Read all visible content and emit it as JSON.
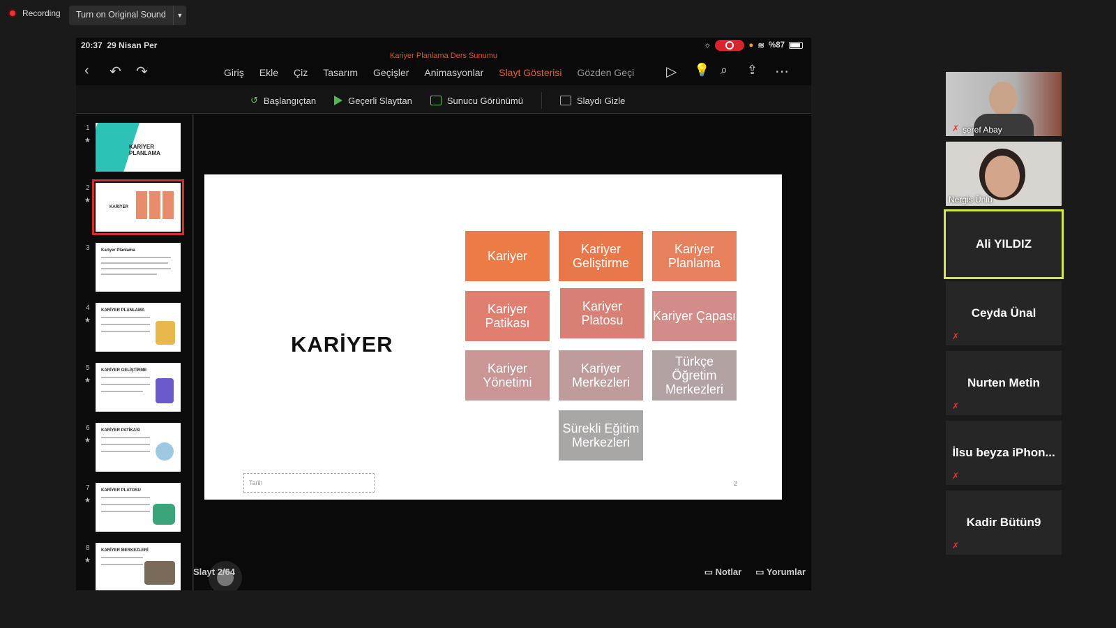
{
  "recording": {
    "label": "Recording"
  },
  "sound_button": {
    "label": "Turn on Original Sound"
  },
  "ipad": {
    "time": "20:37",
    "date": "29 Nisan Per",
    "battery": "%87",
    "doc_title": "Kariyer Planlama Ders Sunumu",
    "menu": [
      "Giriş",
      "Ekle",
      "Çiz",
      "Tasarım",
      "Geçişler",
      "Animasyonlar",
      "Slayt Gösterisi",
      "Gözden Geçi"
    ],
    "menu_active": "Slayt Gösterisi",
    "ribbon": [
      "Başlangıçtan",
      "Geçerli Slayttan",
      "Sunucu Görünümü",
      "Slaydı Gizle"
    ],
    "thumbnails": [
      {
        "num": "1",
        "title": "KARİYER PLANLAMA"
      },
      {
        "num": "2",
        "title": "KARİYER"
      },
      {
        "num": "3",
        "title": "Kariyer Planlama"
      },
      {
        "num": "4",
        "title": "KARİYER PLANLAMA"
      },
      {
        "num": "5",
        "title": "KARİYER GELİŞTİRME"
      },
      {
        "num": "6",
        "title": "KARİYER PATİKASI"
      },
      {
        "num": "7",
        "title": "KARİYER PLATOSU"
      },
      {
        "num": "8",
        "title": "KARİYER MERKEZLERİ"
      }
    ],
    "selected_thumbnail": "2",
    "slide": {
      "title": "KARİYER",
      "boxes": [
        {
          "text": "Kariyer",
          "color": "#ec7b45"
        },
        {
          "text": "Kariyer Geliştirme",
          "color": "#e8784a"
        },
        {
          "text": "Kariyer Planlama",
          "color": "#e7805c"
        },
        {
          "text": "Kariyer Patikası",
          "color": "#de7f70"
        },
        {
          "text": "Kariyer Platosu",
          "color": "#d98076"
        },
        {
          "text": "Kariyer Çapası",
          "color": "#d38c88"
        },
        {
          "text": "Kariyer Yönetimi",
          "color": "#c99595"
        },
        {
          "text": "Kariyer Merkezleri",
          "color": "#bf9b9b"
        },
        {
          "text": "Türkçe Öğretim Merkezleri",
          "color": "#b3a2a2"
        },
        {
          "text": "Sürekli Eğitim Merkezleri",
          "color": "#a9a6a6"
        }
      ],
      "date_placeholder": "Tarih",
      "page_number": "2"
    },
    "slide_count": "Slayt 2/64",
    "notes_label": "Notlar",
    "comments_label": "Yorumlar"
  },
  "participants": [
    {
      "name": "şeref Abay",
      "video": true,
      "muted": true
    },
    {
      "name": "Nergis Ünlü",
      "video": true,
      "muted": false
    },
    {
      "name": "Ali YILDIZ",
      "video": false,
      "muted": false,
      "active": true
    },
    {
      "name": "Ceyda Ünal",
      "video": false,
      "muted": true
    },
    {
      "name": "Nurten Metin",
      "video": false,
      "muted": true
    },
    {
      "name": "İlsu beyza iPhon...",
      "video": false,
      "muted": true
    },
    {
      "name": "Kadir Bütün9",
      "video": false,
      "muted": true
    }
  ]
}
